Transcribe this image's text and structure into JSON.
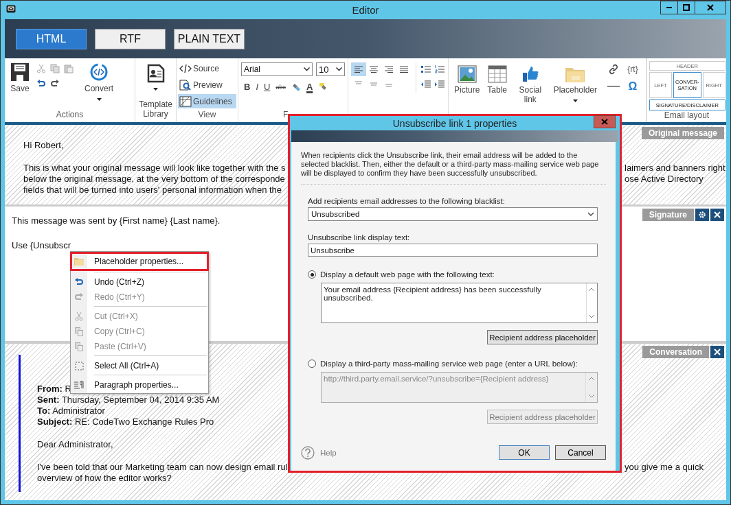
{
  "window": {
    "title": "Editor"
  },
  "format_tabs": [
    {
      "label": "HTML",
      "selected": true
    },
    {
      "label": "RTF",
      "selected": false
    },
    {
      "label": "PLAIN TEXT",
      "selected": false
    }
  ],
  "ribbon": {
    "actions": {
      "save": "Save",
      "convert": "Convert",
      "label": "Actions"
    },
    "template": {
      "label": "Template Library"
    },
    "view": {
      "label": "View",
      "items": [
        {
          "kind": "source",
          "label": "Source",
          "selected": false
        },
        {
          "kind": "preview",
          "label": "Preview",
          "selected": false
        },
        {
          "kind": "guidelines",
          "label": "Guidelines",
          "selected": true
        }
      ]
    },
    "font": {
      "family": "Arial",
      "size": "10",
      "label": "F",
      "buttons": [
        {
          "kind": "bold",
          "label": "B"
        },
        {
          "kind": "italic",
          "label": "I"
        },
        {
          "kind": "underline",
          "label": "U"
        },
        {
          "kind": "strike",
          "label": "abc"
        },
        {
          "kind": "clear"
        },
        {
          "kind": "color",
          "label": "A"
        },
        {
          "kind": "highlight"
        }
      ]
    },
    "alignments": [
      {
        "kind": "left",
        "selected": true
      },
      {
        "kind": "center",
        "selected": false
      },
      {
        "kind": "right",
        "selected": false
      },
      {
        "kind": "justify",
        "selected": false
      }
    ],
    "insert": [
      {
        "kind": "picture",
        "label": "Picture"
      },
      {
        "kind": "table",
        "label": "Table"
      },
      {
        "kind": "social",
        "label": "Social link"
      },
      {
        "kind": "placeholder",
        "label": "Placeholder"
      }
    ],
    "extras": {
      "rt": "{rt}",
      "omega": "Ω"
    },
    "email_layout": {
      "label": "Email layout",
      "items": [
        {
          "label": "HEADER",
          "selected": false
        },
        {
          "label": "LEFT",
          "selected": false
        },
        {
          "label": "CONVER-SATION",
          "selected": true
        },
        {
          "label": "RIGHT",
          "selected": false
        },
        {
          "label": "SIGNATURE/DISCLAIMER",
          "selected": true
        }
      ]
    }
  },
  "original": {
    "tag": "Original message",
    "greeting": "Hi Robert,",
    "lines_left": [
      "This is what your original message will look like together with the s",
      "below the original message, at the very bottom of the corresponde",
      "fields that will be turned into users' personal information when the"
    ],
    "lines_right": [
      "laimers and banners right",
      "ose Active Directory"
    ]
  },
  "signature": {
    "tag": "Signature",
    "lines": [
      "This message was sent by {First name} {Last name}.",
      "Use {Unsubscr"
    ]
  },
  "conversation": {
    "tag": "Conversation",
    "headers": [
      {
        "label": "From:",
        "value": "R"
      },
      {
        "label": "Sent:",
        "value": "Thursday, September 04, 2014 9:35 AM"
      },
      {
        "label": "To:",
        "value": "Administrator"
      },
      {
        "label": "Subject:",
        "value": "RE: CodeTwo Exchange Rules Pro"
      }
    ],
    "greeting": "Dear Administrator,",
    "lines_left": [
      "I've been told that our Marketing team can now design email rul",
      "overview of how the editor works?"
    ],
    "lines_right": [
      "you give me a quick"
    ]
  },
  "context_menu": {
    "groups": [
      [
        {
          "kind": "placeholder",
          "label": "Placeholder properties...",
          "disabled": false,
          "highlighted": true
        }
      ],
      [
        {
          "kind": "undo",
          "label": "Undo (Ctrl+Z)",
          "disabled": false,
          "highlighted": false
        },
        {
          "kind": "redo",
          "label": "Redo (Ctrl+Y)",
          "disabled": true,
          "highlighted": false
        }
      ],
      [
        {
          "kind": "cut",
          "label": "Cut (Ctrl+X)",
          "disabled": true,
          "highlighted": false
        },
        {
          "kind": "copy",
          "label": "Copy (Ctrl+C)",
          "disabled": true,
          "highlighted": false
        },
        {
          "kind": "paste",
          "label": "Paste (Ctrl+V)",
          "disabled": true,
          "highlighted": false
        }
      ],
      [
        {
          "kind": "selectall",
          "label": "Select All (Ctrl+A)",
          "disabled": false,
          "highlighted": false
        }
      ],
      [
        {
          "kind": "paragraph",
          "label": "Paragraph properties...",
          "disabled": false,
          "highlighted": false
        }
      ]
    ]
  },
  "dialog": {
    "title": "Unsubscribe link 1 properties",
    "highlighted": true,
    "description": "When recipients click the Unsubscribe link, their email address will be added to the selected blacklist. Then, either the default or a third-party mass-mailing service web page will be displayed to confirm they have been successfully unsubscribed.",
    "blacklist_label": "Add recipients email addresses to the following blacklist:",
    "blacklist_value": "Unsubscribed",
    "display_text_label": "Unsubscribe link display text:",
    "display_text_value": "Unsubscribe",
    "options": [
      {
        "label": "Display a default web page with the following text:",
        "selected": true,
        "text": "Your email address {Recipient address} has been successfully unsubscribed.",
        "button": "Recipient address placeholder",
        "disabled": false
      },
      {
        "label": "Display a third-party mass-mailing service web page (enter a URL below):",
        "selected": false,
        "text": "http://third.party.email.service/?unsubscribe={Recipient address}",
        "button": "Recipient address placeholder",
        "disabled": true
      }
    ],
    "help": "Help",
    "ok": "OK",
    "cancel": "Cancel"
  }
}
